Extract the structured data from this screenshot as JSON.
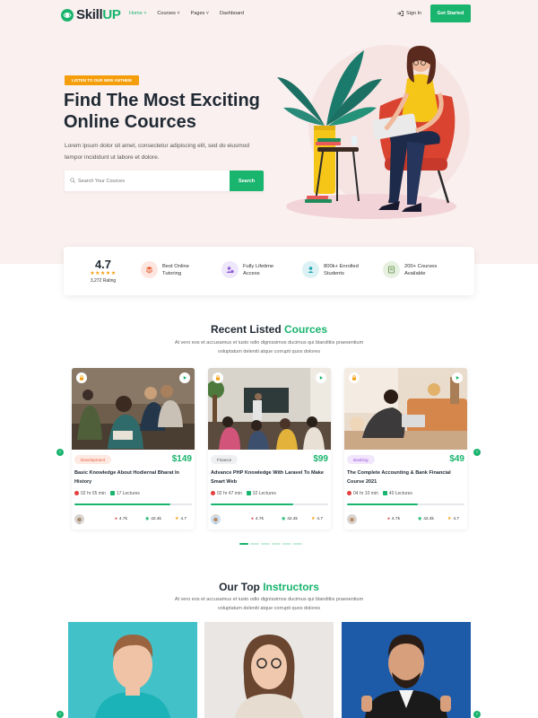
{
  "brand": {
    "logo_prefix": "Skill",
    "logo_suffix": "UP",
    "accent": "#19b46e"
  },
  "nav": {
    "items": [
      {
        "label": "Home",
        "has_chevron": true,
        "active": true
      },
      {
        "label": "Courses",
        "has_chevron": true
      },
      {
        "label": "Pages",
        "has_chevron": true
      },
      {
        "label": "Dashboard",
        "has_chevron": false
      }
    ],
    "signin_label": "Sign In",
    "cta_label": "Get Started"
  },
  "hero": {
    "badge": "LISTEN TO OUR NEW ANTHEM",
    "title_line1": "Find The Most Exciting",
    "title_line2": "Online Cources",
    "subtitle": "Lorem ipsum dolor sit amet, consectetur adipiscing elit, sed do eiusmod tempor incididunt ut labore et dolore.",
    "search_placeholder": "Search Your Cources",
    "search_button": "Search"
  },
  "stats": {
    "rating_value": "4.7",
    "rating_count": "3,272 Rating",
    "features": [
      {
        "icon": "layers-icon",
        "line1": "Best Online",
        "line2": "Tutoring"
      },
      {
        "icon": "lifetime-access-icon",
        "line1": "Fully Lifetime",
        "line2": "Access"
      },
      {
        "icon": "students-icon",
        "line1": "800k+ Enrolled",
        "line2": "Students"
      },
      {
        "icon": "courses-available-icon",
        "line1": "200+ Courses",
        "line2": "Available"
      }
    ]
  },
  "recent": {
    "title_a": "Recent Listed",
    "title_b": "Cources",
    "subtitle_line1": "At vero eos et accusamus et iusto odio dignissimos ducimus qui blanditiis praesentium",
    "subtitle_line2": "voluptatum deleniti atque corrupti quos dolores",
    "courses": [
      {
        "tag": "Development",
        "tag_bg": "#fde8e2",
        "tag_color": "#e8623a",
        "price": "$149",
        "title": "Basic Knowledge About Hodiernal Bharat In History",
        "duration": "02 hr 05 min",
        "lectures": "17 Lectures",
        "progress": 0.82,
        "students": "4.7k",
        "views": "42.4k",
        "rating": "4.7"
      },
      {
        "tag": "Finance",
        "tag_bg": "#eef0f2",
        "tag_color": "#555555",
        "price": "$99",
        "title": "Advance PHP Knowledge With Laravel To Make Smart Web",
        "duration": "02 hr 47 min",
        "lectures": "32 Lectures",
        "progress": 0.7,
        "students": "4.7k",
        "views": "42.4k",
        "rating": "4.7"
      },
      {
        "tag": "Banking",
        "tag_bg": "#f1e6fb",
        "tag_color": "#9b51e0",
        "price": "$49",
        "title": "The Complete Accounting & Bank Financial Course 2021",
        "duration": "04 hr 10 min",
        "lectures": "40 Lectures",
        "progress": 0.6,
        "students": "4.7k",
        "views": "42.4k",
        "rating": "4.7"
      }
    ]
  },
  "instructors": {
    "title_a": "Our Top",
    "title_b": "Instructors",
    "subtitle_line1": "At vero eos et accusamus et iusto odio dignissimos ducimus qui blanditiis praesentium",
    "subtitle_line2": "voluptatum deleniti atque corrupti quos dolores"
  }
}
